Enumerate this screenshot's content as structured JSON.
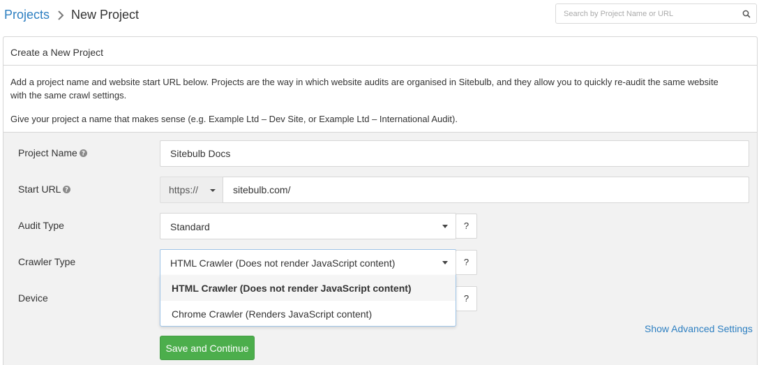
{
  "breadcrumb": {
    "root": "Projects",
    "current": "New Project"
  },
  "search": {
    "placeholder": "Search by Project Name or URL"
  },
  "panel": {
    "title": "Create a New Project",
    "description": "Add a project name and website start URL below. Projects are the way in which website audits are organised in Sitebulb, and they allow you to quickly re-audit the same website with the same crawl settings.",
    "hint": "Give your project a name that makes sense (e.g. Example Ltd – Dev Site, or Example Ltd – International Audit)."
  },
  "form": {
    "project_name": {
      "label": "Project Name",
      "value": "Sitebulb Docs"
    },
    "start_url": {
      "label": "Start URL",
      "protocol": "https://",
      "value": "sitebulb.com/"
    },
    "audit_type": {
      "label": "Audit Type",
      "value": "Standard",
      "help": "?"
    },
    "crawler_type": {
      "label": "Crawler Type",
      "value": "HTML Crawler (Does not render JavaScript content)",
      "help": "?",
      "options": [
        "HTML Crawler (Does not render JavaScript content)",
        "Chrome Crawler (Renders JavaScript content)"
      ]
    },
    "device": {
      "label": "Device",
      "help": "?"
    }
  },
  "advanced_link": "Show Advanced Settings",
  "save_button": "Save and Continue",
  "colors": {
    "link": "#2d7fc1",
    "primary_button": "#4cae4c",
    "dropdown_border": "#9ec3e6"
  }
}
